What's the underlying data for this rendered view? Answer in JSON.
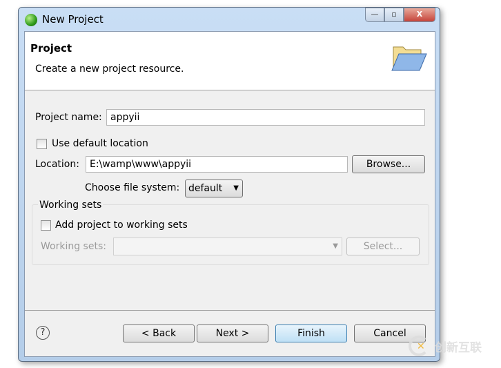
{
  "window": {
    "title": "New Project",
    "controls": {
      "minimize": "—",
      "maximize": "▫",
      "close": "X"
    }
  },
  "header": {
    "title": "Project",
    "description": "Create a new project resource.",
    "icon": "open-folder-icon"
  },
  "form": {
    "project_name_label": "Project name:",
    "project_name_value": "appyii",
    "use_default_label": "Use default location",
    "use_default_checked": false,
    "location_label": "Location:",
    "location_value": "E:\\wamp\\www\\appyii",
    "browse_label": "Browse...",
    "file_system_label": "Choose file system:",
    "file_system_value": "default"
  },
  "working_sets": {
    "group_label": "Working sets",
    "add_label": "Add project to working sets",
    "add_checked": false,
    "sets_label": "Working sets:",
    "sets_value": "",
    "select_label": "Select..."
  },
  "footer": {
    "help_icon": "?",
    "back": "< Back",
    "next": "Next >",
    "finish": "Finish",
    "cancel": "Cancel"
  },
  "watermark": "创新互联"
}
